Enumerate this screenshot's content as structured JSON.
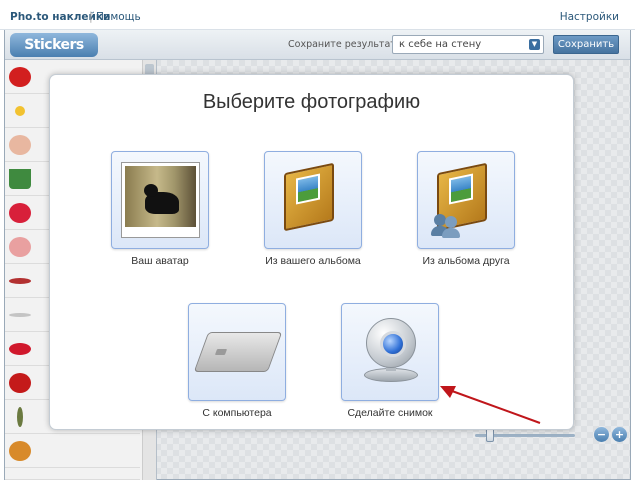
{
  "topbar": {
    "app_name": "Pho.to наклейки",
    "separator": "|",
    "help": "Помощь",
    "settings": "Настройки"
  },
  "app": {
    "logo_text": "Stickers",
    "save_result_label": "Сохраните результат",
    "save_target": "к себе на стену",
    "save_button": "Сохранить"
  },
  "modal": {
    "title": "Выберите фотографию",
    "options": [
      {
        "label": "Ваш аватар",
        "icon": "avatar-photo-icon"
      },
      {
        "label": "Из вашего альбома",
        "icon": "album-icon"
      },
      {
        "label": "Из альбома друга",
        "icon": "friend-album-icon"
      },
      {
        "label": "С компьютера",
        "icon": "hard-drive-icon"
      },
      {
        "label": "Сделайте снимок",
        "icon": "webcam-icon"
      }
    ]
  },
  "zoom": {
    "minus": "−",
    "plus": "+",
    "level": 0.15
  },
  "colors": {
    "link": "#2b587a",
    "tile_border": "#8faee0",
    "arrow": "#c0161b",
    "button": "#45739f"
  }
}
